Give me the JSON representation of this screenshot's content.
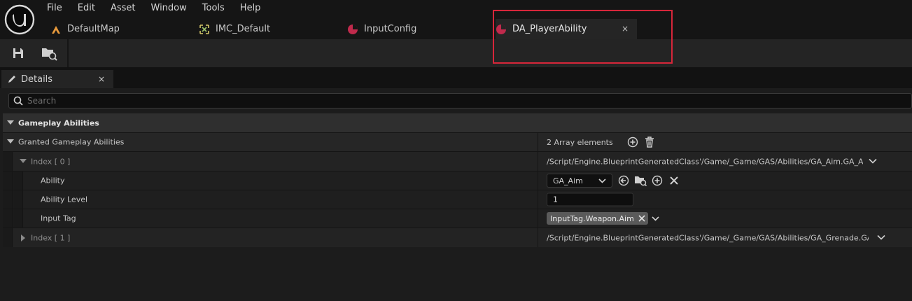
{
  "menu": [
    "File",
    "Edit",
    "Asset",
    "Window",
    "Tools",
    "Help"
  ],
  "tabs": [
    {
      "label": "DefaultMap",
      "icon": "level-icon"
    },
    {
      "label": "IMC_Default",
      "icon": "input-mapping-context-icon"
    },
    {
      "label": "InputConfig",
      "icon": "data-asset-icon"
    },
    {
      "label": "DA_PlayerAbility",
      "icon": "data-asset-icon",
      "active": true,
      "close": "×"
    }
  ],
  "toolbar": {
    "save": "save-icon",
    "browse": "browse-to-asset-icon"
  },
  "details": {
    "tab_label": "Details",
    "tab_close": "×",
    "search_placeholder": "Search",
    "category": "Gameplay Abilities",
    "array_label": "Granted Gameplay Abilities",
    "array_count": "2 Array elements",
    "index0": {
      "label": "Index [ 0 ]",
      "value": "/Script/Engine.BlueprintGeneratedClass'/Game/_Game/GAS/Abilities/GA_Aim.GA_Aim_C'",
      "ability_label": "Ability",
      "ability_value": "GA_Aim",
      "level_label": "Ability Level",
      "level_value": "1",
      "tag_label": "Input Tag",
      "tag_value": "InputTag.Weapon.Aim"
    },
    "index1": {
      "label": "Index [ 1 ]",
      "value": "/Script/Engine.BlueprintGeneratedClass'/Game/_Game/GAS/Abilities/GA_Grenade.GA_Grenade_C'"
    }
  },
  "colors": {
    "highlight": "#d7263a",
    "asset_icon": "#c02a4c",
    "level_icon": "#e89a3c"
  }
}
